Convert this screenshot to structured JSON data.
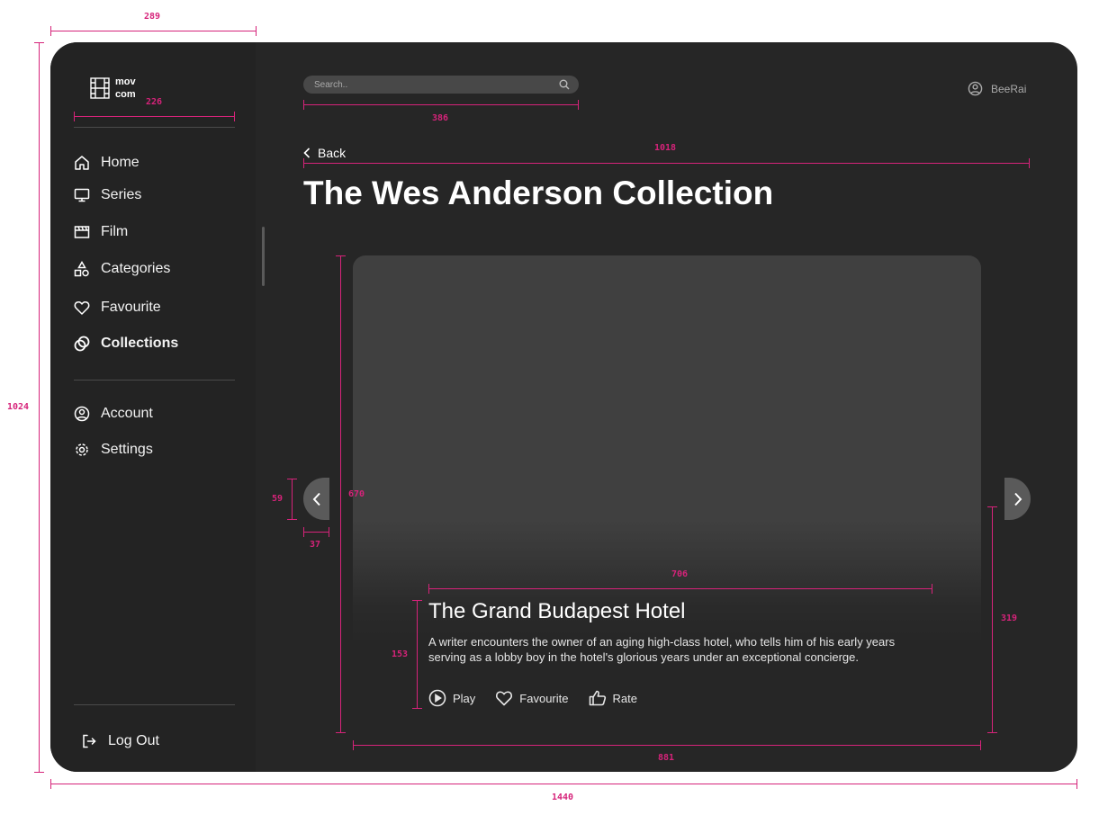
{
  "brand": {
    "line1": "mov",
    "line2": "com"
  },
  "nav": {
    "items": [
      {
        "label": "Home",
        "icon": "home-icon"
      },
      {
        "label": "Series",
        "icon": "monitor-icon"
      },
      {
        "label": "Film",
        "icon": "clapperboard-icon"
      },
      {
        "label": "Categories",
        "icon": "shapes-icon"
      },
      {
        "label": "Favourite",
        "icon": "heart-icon"
      },
      {
        "label": "Collections",
        "icon": "collections-icon",
        "active": true
      }
    ],
    "secondary": [
      {
        "label": "Account",
        "icon": "user-circle-icon"
      },
      {
        "label": "Settings",
        "icon": "gear-icon"
      }
    ],
    "logout": "Log Out"
  },
  "search": {
    "placeholder": "Search.."
  },
  "user": {
    "name": "BeeRai"
  },
  "back_label": "Back",
  "page_title": "The Wes Anderson Collection",
  "feature": {
    "title": "The Grand Budapest Hotel",
    "description": "A writer encounters the owner of an aging high-class hotel, who tells him of his early years serving as a lobby boy in the hotel's glorious years under an exceptional concierge.",
    "actions": {
      "play": "Play",
      "favourite": "Favourite",
      "rate": "Rate"
    }
  },
  "dimensions": {
    "app_width": "1440",
    "app_height": "1024",
    "sidebar": "289",
    "logo_divider": "226",
    "search": "386",
    "content": "1018",
    "card_height": "670",
    "arrow_height": "59",
    "arrow_width": "37",
    "info_width": "706",
    "info_height": "153",
    "gradient": "319",
    "card_width": "881"
  },
  "colors": {
    "background": "#262626",
    "sidebar": "#232323",
    "card": "#404040",
    "annotation": "#d6237a"
  }
}
